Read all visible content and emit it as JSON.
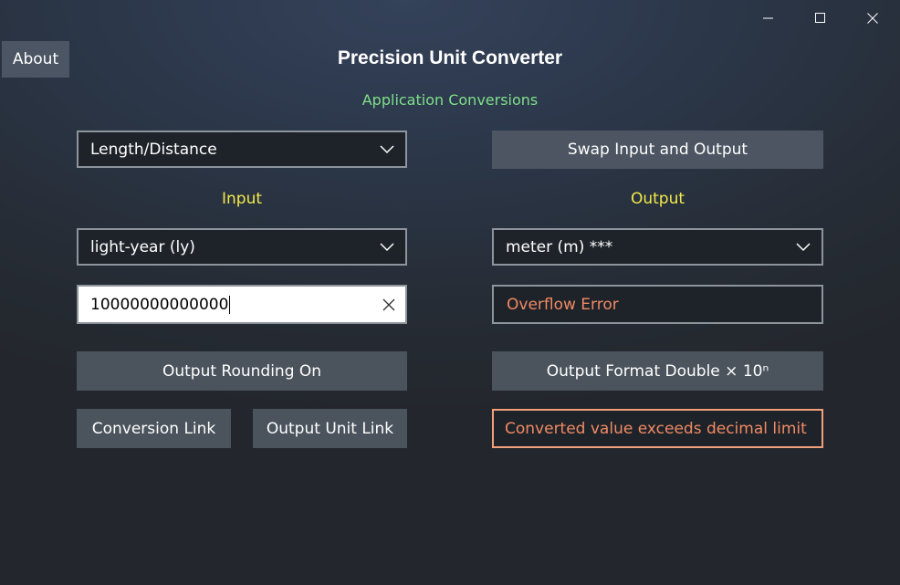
{
  "app": {
    "title": "Precision Unit Converter",
    "subtitle": "Application Conversions"
  },
  "window_controls": {
    "minimize_icon": "minimize-icon",
    "maximize_icon": "maximize-icon",
    "close_icon": "close-icon"
  },
  "about_label": "About",
  "category": {
    "selected": "Length/Distance"
  },
  "swap_label": "Swap Input and Output",
  "input": {
    "label": "Input",
    "unit": "light-year (ly)",
    "value": "10000000000000"
  },
  "output": {
    "label": "Output",
    "unit": "meter (m) ***",
    "value": "Overflow Error"
  },
  "rounding_label": "Output Rounding On",
  "format_label": "Output Format Double × 10ⁿ",
  "conversion_link_label": "Conversion Link",
  "output_unit_link_label": "Output Unit Link",
  "warning": "Converted value exceeds decimal limit",
  "colors": {
    "subtitle": "#7ee08a",
    "labels": "#f4e94a",
    "error": "#f08a63",
    "warning_border": "#f2a07b"
  }
}
